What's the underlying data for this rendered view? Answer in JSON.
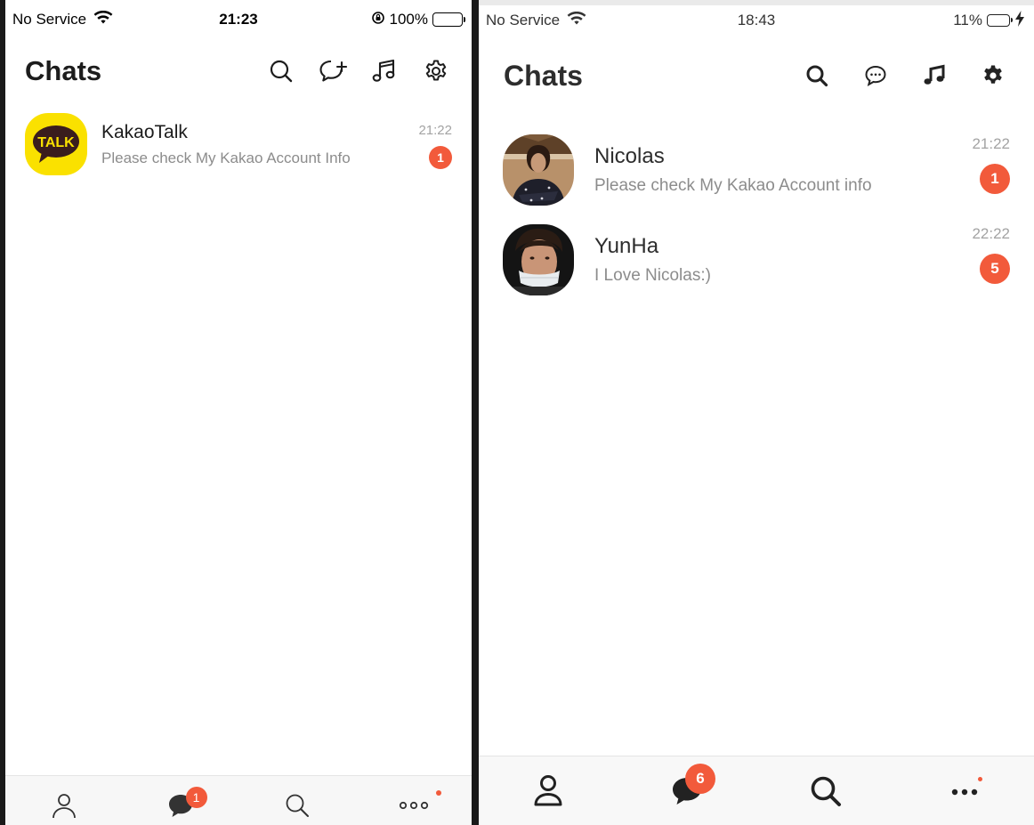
{
  "colors": {
    "badge": "#f25a3b",
    "kakao_yellow": "#fae100",
    "kakao_brown": "#3a1d1d"
  },
  "left_screen": {
    "status": {
      "carrier": "No Service",
      "time": "21:23",
      "battery": "100%",
      "battery_fill": 1.0
    },
    "title": "Chats",
    "header_icons": [
      "search-icon",
      "new-chat-icon",
      "music-icon",
      "gear-icon"
    ],
    "chats": [
      {
        "name": "KakaoTalk",
        "avatar_text": "TALK",
        "preview": "Please check My Kakao Account Info",
        "time": "21:22",
        "unread": "1"
      }
    ],
    "tabs": [
      {
        "icon": "person-icon",
        "badge": ""
      },
      {
        "icon": "chat-bubble-icon",
        "badge": "1"
      },
      {
        "icon": "search-icon",
        "badge": ""
      },
      {
        "icon": "more-icon",
        "dot": true
      }
    ]
  },
  "right_screen": {
    "status": {
      "carrier": "No Service",
      "time": "18:43",
      "battery": "11%",
      "battery_fill": 0.11
    },
    "title": "Chats",
    "header_icons": [
      "search-icon",
      "chat-bubble-icon",
      "music-icon",
      "gear-icon"
    ],
    "chats": [
      {
        "name": "Nicolas",
        "preview": "Please check My Kakao Account info",
        "time": "21:22",
        "unread": "1"
      },
      {
        "name": "YunHa",
        "preview": "I Love Nicolas:)",
        "time": "22:22",
        "unread": "5"
      }
    ],
    "tabs": [
      {
        "icon": "person-icon",
        "badge": ""
      },
      {
        "icon": "chat-bubble-icon",
        "badge": "6"
      },
      {
        "icon": "search-icon",
        "badge": ""
      },
      {
        "icon": "more-icon",
        "dot": true
      }
    ]
  }
}
